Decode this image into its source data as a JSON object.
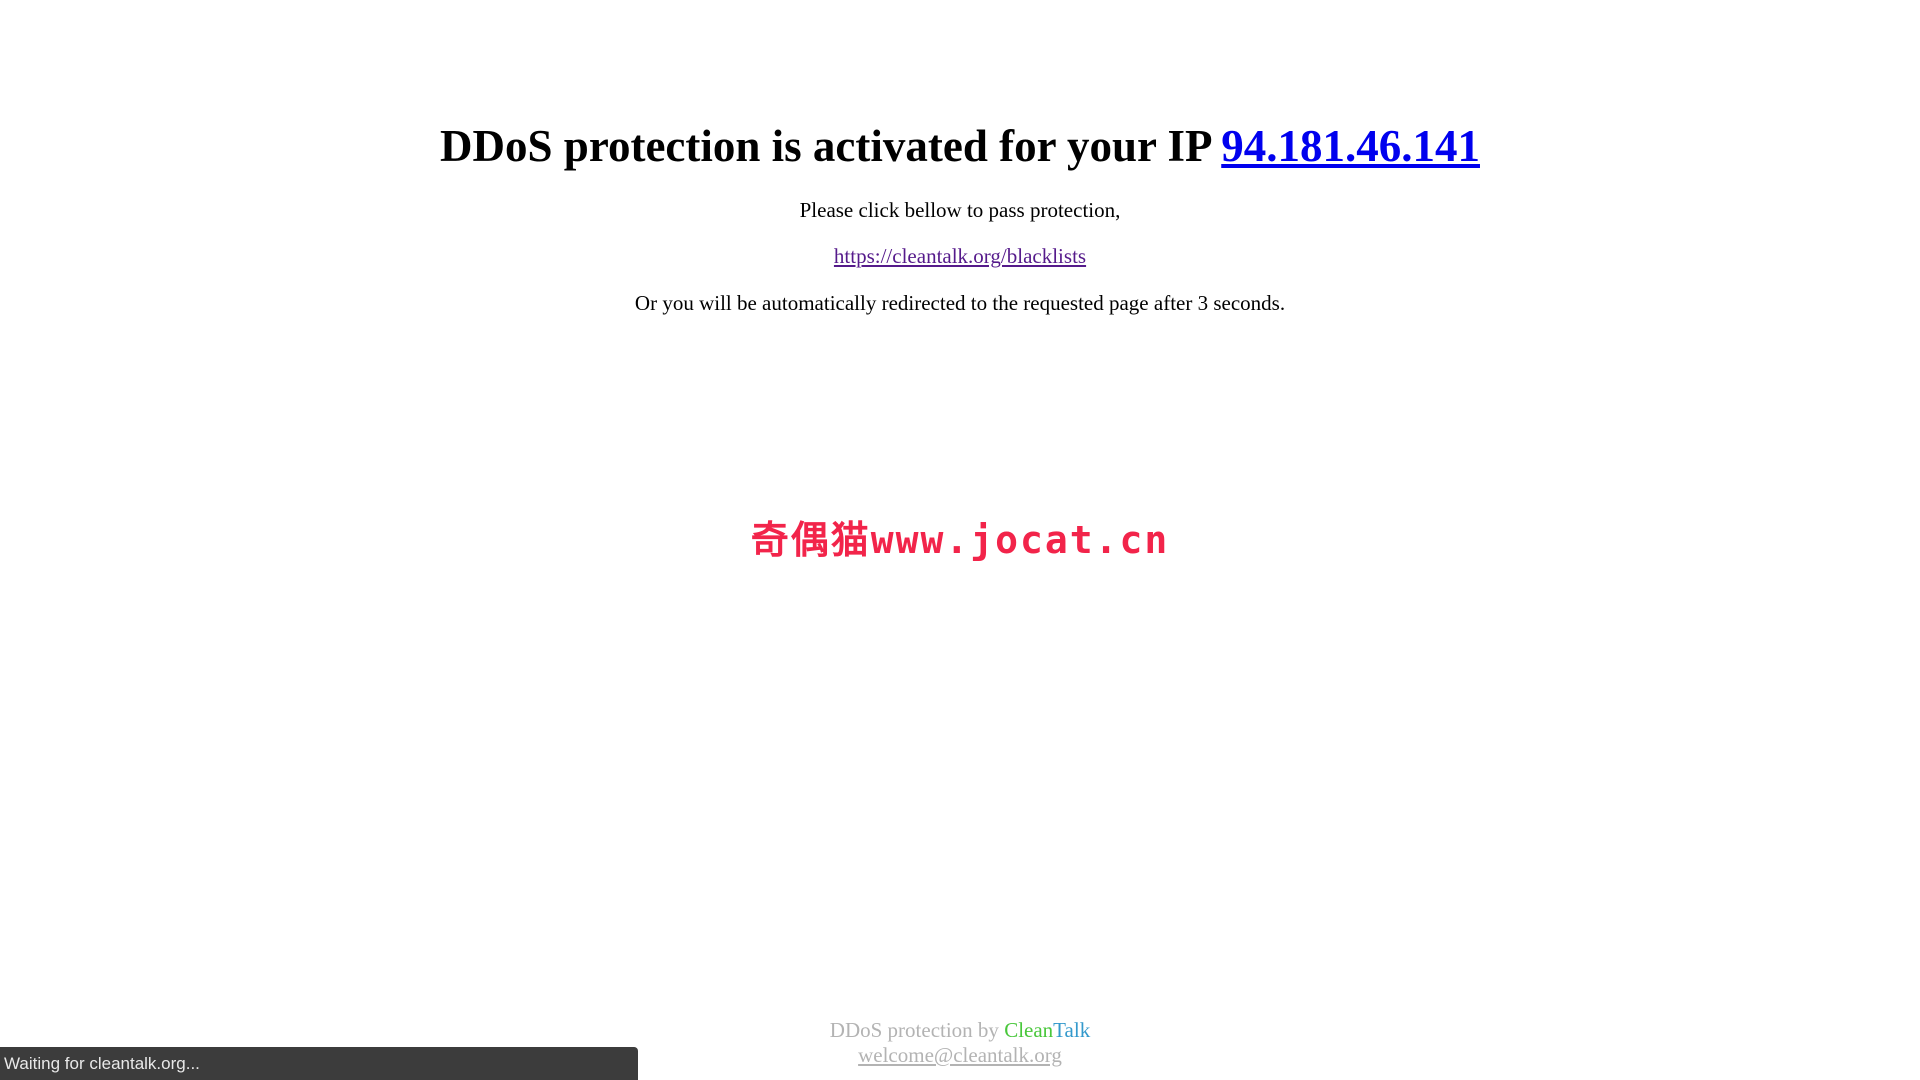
{
  "headline": {
    "text": "DDoS protection is activated for your IP ",
    "ip": "94.181.46.141"
  },
  "instruction": "Please click bellow to pass protection,",
  "pass_link": "https://cleantalk.org/blacklists",
  "redirect_text": "Or you will be automatically redirected to the requested page after 3 seconds.",
  "watermark": "奇偶猫www.jocat.cn",
  "footer": {
    "prefix": "DDoS protection by ",
    "brand_clean": "Clean",
    "brand_talk": "Talk",
    "email": "welcome@cleantalk.org"
  },
  "status_bar": "Waiting for cleantalk.org...",
  "colors": {
    "link": "#0000ee",
    "visited_link": "#551a8b",
    "watermark": "#f2244a",
    "brand_clean": "#49c73b",
    "brand_talk": "#3399cc",
    "footer_text": "#b3b3b3"
  }
}
